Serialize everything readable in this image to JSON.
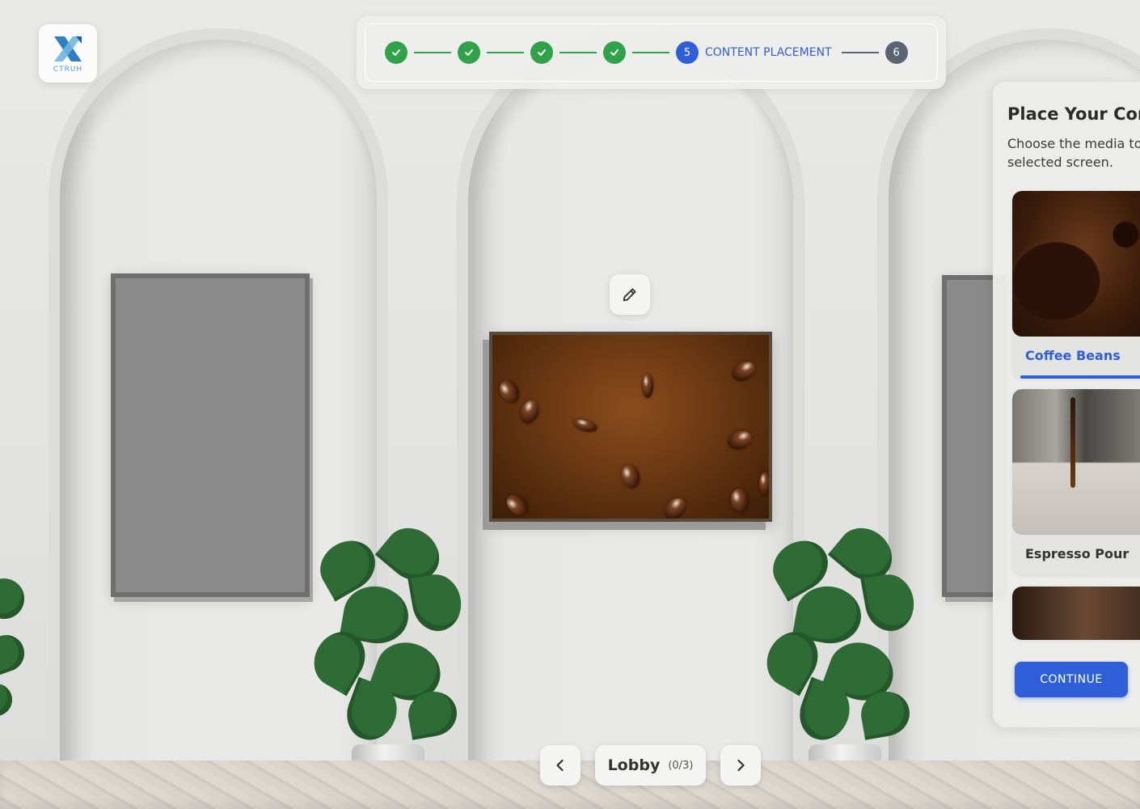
{
  "app": {
    "logo_text": "CTRUH"
  },
  "stepper": {
    "completed_steps": [
      "check",
      "check",
      "check",
      "check"
    ],
    "active_step": {
      "number": "5",
      "label": "CONTENT PLACEMENT"
    },
    "next_step": {
      "number": "6"
    },
    "colors": {
      "done": "#2fa24a",
      "active": "#2f5fd8",
      "pending": "#5b6473"
    }
  },
  "panel": {
    "title": "Place Your Cont",
    "subtitle": "Choose the media to selected screen.",
    "media": [
      {
        "label": "Coffee Beans",
        "selected": true
      },
      {
        "label": "Espresso Pour",
        "selected": false
      },
      {
        "label": "",
        "selected": false
      }
    ],
    "continue_label": "CONTINUE"
  },
  "room_nav": {
    "room_name": "Lobby",
    "room_count": "(0/3)",
    "prev_icon": "chevron-left-icon",
    "next_icon": "chevron-right-icon"
  },
  "icons": {
    "edit": "pencil-icon",
    "logo": "ctruh-logo-icon"
  }
}
